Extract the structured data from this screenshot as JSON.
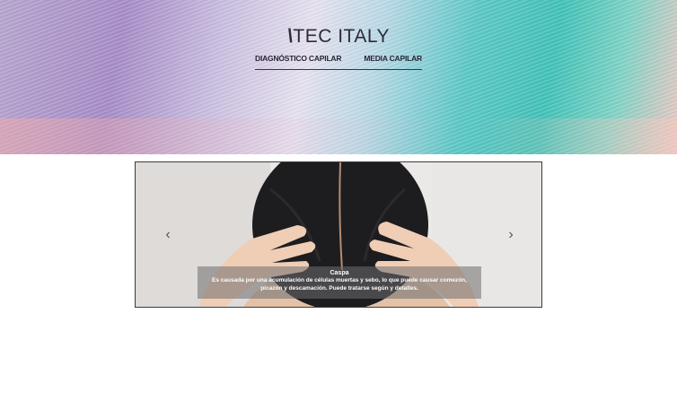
{
  "brand": {
    "mark": "\\",
    "name": "TEC ITALY"
  },
  "nav": {
    "items": [
      {
        "label": "DIAGNÓSTICO CAPILAR"
      },
      {
        "label": "MEDIA CAPILAR"
      }
    ]
  },
  "carousel": {
    "prev_icon": "‹",
    "next_icon": "›",
    "slide": {
      "title": "Caspa",
      "text": "Es causada por una acumulación de células muertas y sebo, lo que puede causar comezón, picazón y descamación. Puede tratarse según y detalles."
    }
  }
}
